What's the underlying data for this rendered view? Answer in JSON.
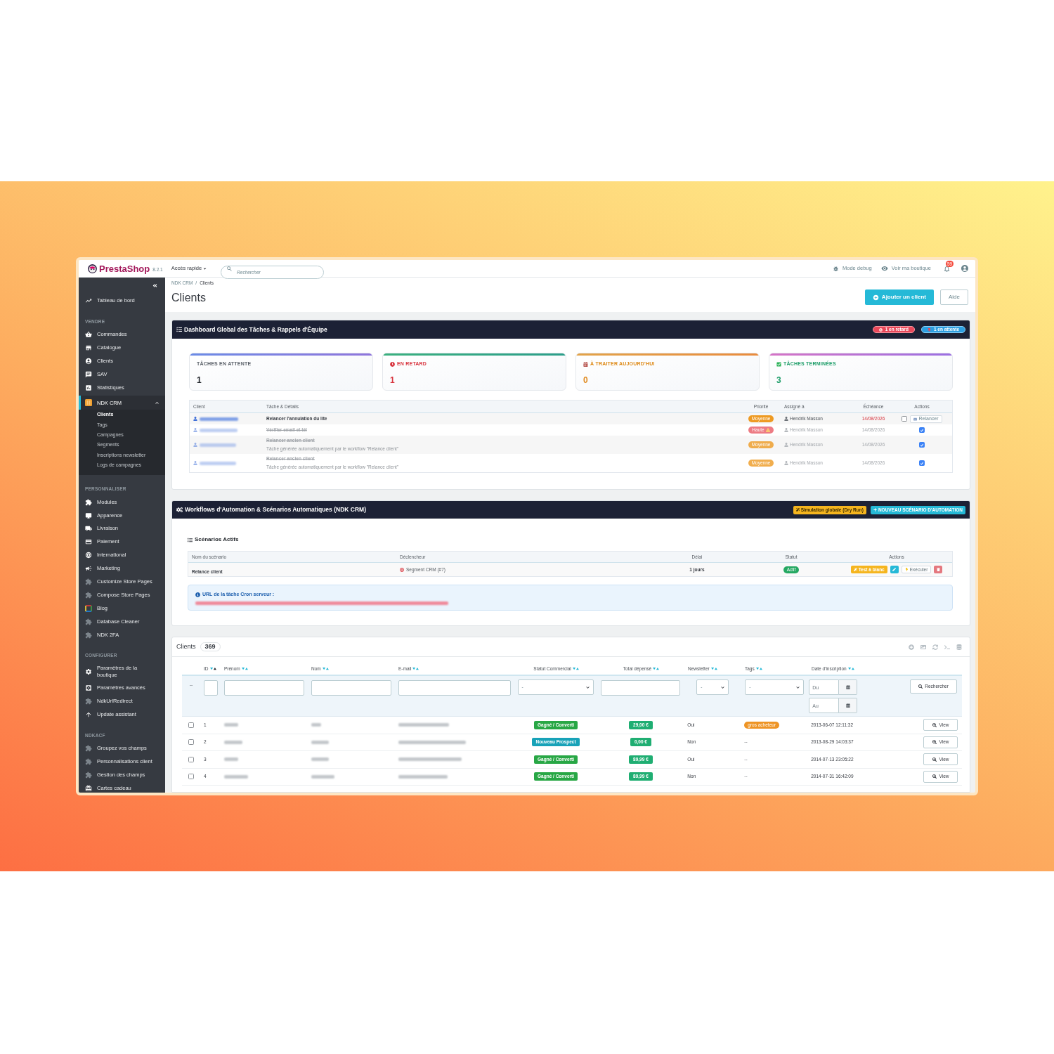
{
  "header": {
    "logo": "PrestaShop",
    "version": "8.2.1",
    "quick_access": "Accès rapide",
    "search": {
      "placeholder": "Rechercher"
    },
    "links": [
      {
        "label": "Mode debug",
        "kind": "debug"
      },
      {
        "label": "Voir ma boutique",
        "kind": "shop"
      }
    ],
    "notifications": "59"
  },
  "sidebar": {
    "sections": [
      {
        "items": [
          {
            "label": "Tableau de bord",
            "selected": false
          }
        ]
      },
      {
        "title": "VENDRE",
        "items": [
          {
            "label": "Commandes",
            "selected": false
          },
          {
            "label": "Catalogue",
            "selected": false
          },
          {
            "label": "Clients",
            "selected": false
          },
          {
            "label": "SAV",
            "selected": false
          },
          {
            "label": "Statistiques",
            "selected": false
          },
          {
            "label": "NDK CRM",
            "selected": true,
            "expanded": true,
            "children": [
              {
                "label": "Clients",
                "selected": true
              },
              {
                "label": "Tags",
                "selected": false
              },
              {
                "label": "Campagnes",
                "selected": false
              },
              {
                "label": "Segments",
                "selected": false
              },
              {
                "label": "Inscriptions newsletter",
                "selected": false
              },
              {
                "label": "Logs de campagnes",
                "selected": false
              }
            ]
          }
        ]
      },
      {
        "title": "PERSONNALISER",
        "items": [
          {
            "label": "Modules",
            "selected": false
          },
          {
            "label": "Apparence",
            "selected": false
          },
          {
            "label": "Livraison",
            "selected": false
          },
          {
            "label": "Paiement",
            "selected": false
          },
          {
            "label": "International",
            "selected": false
          },
          {
            "label": "Marketing",
            "selected": false
          },
          {
            "label": "Customize Store Pages",
            "selected": false
          },
          {
            "label": "Compose Store Pages",
            "selected": false
          },
          {
            "label": "Blog",
            "selected": false
          },
          {
            "label": "Database Cleaner",
            "selected": false
          },
          {
            "label": "NDK 2FA",
            "selected": false
          }
        ]
      },
      {
        "title": "CONFIGURER",
        "items": [
          {
            "label": "Paramètres de la boutique",
            "selected": false
          },
          {
            "label": "Paramètres avancés",
            "selected": false
          },
          {
            "label": "NdkUrlRedirect",
            "selected": false
          },
          {
            "label": "Update assistant",
            "selected": false
          }
        ]
      },
      {
        "title": "NDKACF",
        "items": [
          {
            "label": "Groupez vos champs",
            "selected": false
          },
          {
            "label": "Personnalisations client",
            "selected": false
          },
          {
            "label": "Gestion des champs",
            "selected": false
          },
          {
            "label": "Cartes cadeau",
            "selected": false
          }
        ]
      }
    ]
  },
  "page": {
    "breadcrumb": {
      "items": [
        "NDK CRM",
        "Clients"
      ],
      "separator": "/"
    },
    "title": "Clients",
    "actions": [
      {
        "label": "Ajouter un client",
        "kind": "primary"
      },
      {
        "label": "Aide",
        "kind": "outline"
      }
    ]
  },
  "dashboard": {
    "title": "Dashboard Global des Tâches & Rappels d'Équipe",
    "badges": [
      {
        "label": "1 en retard",
        "kind": "danger"
      },
      {
        "label": "1 en attente",
        "kind": "info"
      }
    ],
    "stats": [
      {
        "label": "TÂCHES EN ATTENTE",
        "value": "1",
        "kind": "pending"
      },
      {
        "label": "EN RETARD",
        "value": "1",
        "kind": "overdue"
      },
      {
        "label": "À TRAITER AUJOURD'HUI",
        "value": "0",
        "kind": "today"
      },
      {
        "label": "TÂCHES TERMINÉES",
        "value": "3",
        "kind": "done"
      }
    ],
    "tasks": {
      "columns": [
        "Client",
        "Tâche & Détails",
        "Priorité",
        "Assigné à",
        "Échéance",
        "Actions"
      ],
      "rows": [
        {
          "task": "Relancer l'annulation du lite",
          "priority": {
            "label": "Moyenne",
            "kind": "medium"
          },
          "assignee": "Hendrik Masson",
          "due": "14/08/2026",
          "overdue": true,
          "done": false,
          "action": "Relancer"
        },
        {
          "task": "Vérifier email et tél",
          "priority": {
            "label": "Haute",
            "kind": "high"
          },
          "assignee": "Hendrik Masson",
          "due": "14/08/2026",
          "overdue": false,
          "done": true
        },
        {
          "task": "Relancer ancien client",
          "details": "Tâche générée automatiquement par le workflow \"Relance client\"",
          "priority": {
            "label": "Moyenne",
            "kind": "medium"
          },
          "assignee": "Hendrik Masson",
          "due": "14/08/2026",
          "overdue": false,
          "done": true
        },
        {
          "task": "Relancer ancien client",
          "details": "Tâche générée automatiquement par le workflow \"Relance client\"",
          "priority": {
            "label": "Moyenne",
            "kind": "medium"
          },
          "assignee": "Hendrik Masson",
          "due": "14/08/2026",
          "overdue": false,
          "done": true
        }
      ]
    }
  },
  "workflows": {
    "title": "Workflows d'Automation & Scénarios Automatiques (NDK CRM)",
    "actions": [
      {
        "label": "Simulation globale (Dry Run)",
        "kind": "simulate"
      },
      {
        "label": "NOUVEAU SCÉNARIO D'AUTOMATION",
        "kind": "create"
      }
    ],
    "scenarios": {
      "title": "Scénarios Actifs",
      "columns": [
        "Nom du scénario",
        "Déclencheur",
        "Délai",
        "Statut",
        "Actions"
      ],
      "rows": [
        {
          "name": "Relance client",
          "trigger": "Segment CRM (#7)",
          "delay": "1 jours",
          "status": "Actif",
          "active": true,
          "actions": [
            {
              "kind": "test",
              "label": "Test à blanc"
            },
            {
              "kind": "edit"
            },
            {
              "kind": "run",
              "label": "Exécuter"
            },
            {
              "kind": "delete"
            }
          ]
        }
      ]
    },
    "cron": {
      "title": "URL de la tâche Cron serveur :"
    }
  },
  "clients": {
    "title": "Clients",
    "count": "369",
    "columns": [
      {
        "label": "ID",
        "sorted": true
      },
      {
        "label": "Prénom",
        "sorted": false
      },
      {
        "label": "Nom",
        "sorted": false
      },
      {
        "label": "E-mail",
        "sorted": false
      },
      {
        "label": "Statut Commercial",
        "sorted": false
      },
      {
        "label": "Total dépensé",
        "sorted": false
      },
      {
        "label": "Newsletter",
        "sorted": false
      },
      {
        "label": "Tags",
        "sorted": false
      },
      {
        "label": "Date d'inscription",
        "sorted": false
      }
    ],
    "filters": {
      "lead": "--",
      "fields": [
        {
          "kind": "text"
        },
        {
          "kind": "text"
        },
        {
          "kind": "text"
        },
        {
          "kind": "text"
        },
        {
          "kind": "select",
          "value": "-"
        },
        {
          "kind": "text"
        },
        {
          "kind": "select",
          "value": "-"
        },
        {
          "kind": "select",
          "value": "-"
        },
        {
          "kind": "date_range",
          "from": {
            "placeholder": "Du"
          },
          "to": {
            "placeholder": "Au"
          }
        }
      ],
      "search_button": "Rechercher"
    },
    "rows": [
      {
        "id": "1",
        "checked": false,
        "status": {
          "label": "Gagné / Converti",
          "kind": "won"
        },
        "total": "29,00 €",
        "newsletter": "Oui",
        "tags": {
          "kind": "tag",
          "label": "gros acheteur"
        },
        "date": "2013-06-07 12:11:32",
        "action": "View"
      },
      {
        "id": "2",
        "checked": false,
        "status": {
          "label": "Nouveau Prospect",
          "kind": "prospect"
        },
        "total": "0,00 €",
        "newsletter": "Non",
        "tags": {
          "kind": "none",
          "label": "--"
        },
        "date": "2013-08-29 14:03:37",
        "action": "View"
      },
      {
        "id": "3",
        "checked": false,
        "status": {
          "label": "Gagné / Converti",
          "kind": "won"
        },
        "total": "89,99 €",
        "newsletter": "Oui",
        "tags": {
          "kind": "none",
          "label": "--"
        },
        "date": "2014-07-13 23:05:22",
        "action": "View"
      },
      {
        "id": "4",
        "checked": false,
        "status": {
          "label": "Gagné / Converti",
          "kind": "won"
        },
        "total": "89,99 €",
        "newsletter": "Non",
        "tags": {
          "kind": "none",
          "label": "--"
        },
        "date": "2014-07-31 16:42:09",
        "action": "View"
      }
    ]
  }
}
